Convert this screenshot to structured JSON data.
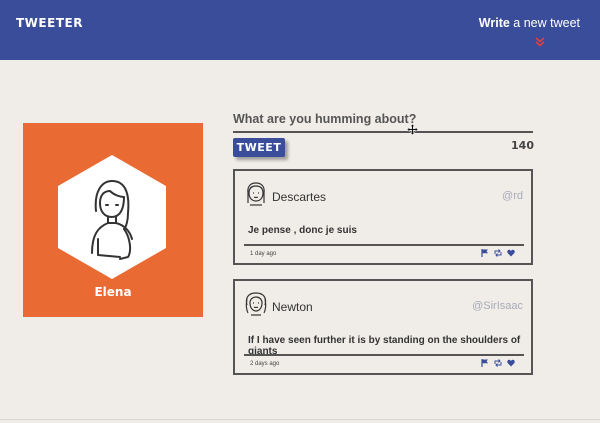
{
  "nav": {
    "brand": "TWEETER",
    "compose_bold": "Write",
    "compose_rest": " a new tweet"
  },
  "profile": {
    "name": "Elena",
    "bg_color": "#ea6a33"
  },
  "composer": {
    "label": "What are you humming about?",
    "button": "TWEET",
    "counter": "140"
  },
  "tweets": [
    {
      "name": "Descartes",
      "handle": "@rd",
      "text": "Je pense , donc je suis",
      "time": "1 day ago"
    },
    {
      "name": "Newton",
      "handle": "@SirIsaac",
      "text": "If I have seen further it is by standing on the shoulders of giants",
      "time": "2 days ago"
    }
  ],
  "colors": {
    "nav": "#3a4d9a",
    "accent_red": "#e0413c",
    "background": "#f0ede9"
  },
  "icons": [
    "flag-icon",
    "retweet-icon",
    "heart-icon",
    "chevron-down-icon",
    "move-cursor-icon"
  ]
}
